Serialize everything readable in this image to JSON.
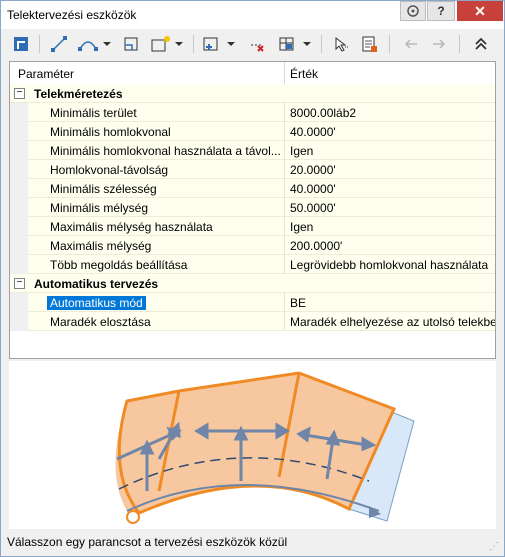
{
  "window": {
    "title": "Telektervezési eszközök"
  },
  "title_buttons": {
    "help": "?",
    "close": "✕"
  },
  "toolbar": {
    "icons": [
      "select-parcel-icon",
      "line-icon",
      "curve-icon",
      "frontage-icon",
      "slide-line-icon",
      "add-icon",
      "delete-icon",
      "table-icon",
      "pick-icon",
      "properties-icon",
      "undo-icon",
      "redo-icon",
      "collapse-icon"
    ]
  },
  "grid": {
    "col_parameter": "Paraméter",
    "col_value": "Érték",
    "cat1": {
      "toggle": "−",
      "label": "Telekméretezés"
    },
    "rows1": [
      {
        "name": "Minimális terület",
        "value": "8000.00láb2"
      },
      {
        "name": "Minimális homlokvonal",
        "value": "40.0000'"
      },
      {
        "name": "Minimális homlokvonal használata a távol...",
        "value": "Igen"
      },
      {
        "name": "Homlokvonal-távolság",
        "value": "20.0000'"
      },
      {
        "name": "Minimális szélesség",
        "value": "40.0000'"
      },
      {
        "name": "Minimális mélység",
        "value": "50.0000'"
      },
      {
        "name": "Maximális mélység használata",
        "value": "Igen"
      },
      {
        "name": "Maximális mélység",
        "value": "200.0000'"
      },
      {
        "name": "Több megoldás beállítása",
        "value": "Legrövidebb homlokvonal használata"
      }
    ],
    "cat2": {
      "toggle": "−",
      "label": "Automatikus tervezés"
    },
    "rows2": [
      {
        "name": "Automatikus mód",
        "value": "BE"
      },
      {
        "name": "Maradék elosztása",
        "value": "Maradék elhelyezése az utolsó telekbe"
      }
    ]
  },
  "status": {
    "text": "Válasszon egy parancsot a tervezési eszközök közül"
  },
  "colors": {
    "accent": "#0078d7",
    "parcel_fill": "#f7c8a0",
    "parcel_edge": "#f08a24",
    "remainder_fill": "#d8e8f8",
    "arrow": "#6f86a8"
  }
}
